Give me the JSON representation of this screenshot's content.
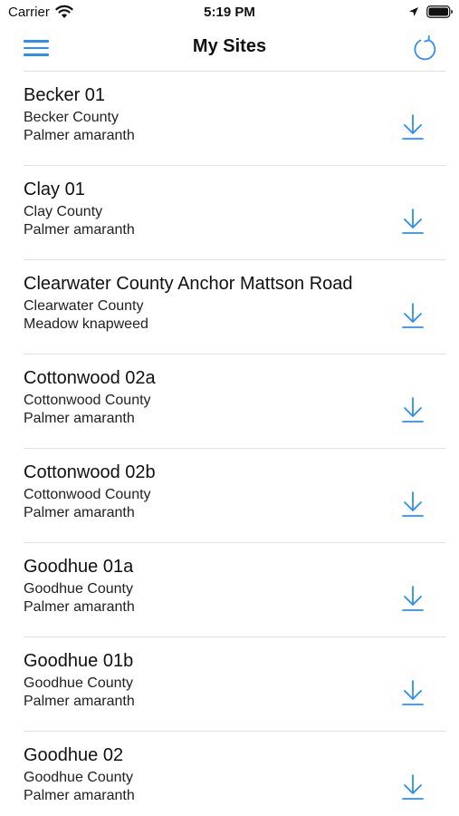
{
  "status_bar": {
    "carrier": "Carrier",
    "time": "5:19 PM"
  },
  "nav": {
    "title": "My Sites",
    "menu_icon": "hamburger-menu-icon",
    "refresh_icon": "refresh-icon"
  },
  "colors": {
    "accent": "#2e8ef0"
  },
  "sites": [
    {
      "name": "Becker 01",
      "county": "Becker County",
      "species": "Palmer amaranth"
    },
    {
      "name": "Clay 01",
      "county": "Clay County",
      "species": "Palmer amaranth"
    },
    {
      "name": "Clearwater County Anchor Mattson Road",
      "county": "Clearwater County",
      "species": "Meadow knapweed"
    },
    {
      "name": "Cottonwood 02a",
      "county": "Cottonwood County",
      "species": "Palmer amaranth"
    },
    {
      "name": "Cottonwood 02b",
      "county": "Cottonwood County",
      "species": "Palmer amaranth"
    },
    {
      "name": "Goodhue 01a",
      "county": "Goodhue County",
      "species": "Palmer amaranth"
    },
    {
      "name": "Goodhue 01b",
      "county": "Goodhue County",
      "species": "Palmer amaranth"
    },
    {
      "name": "Goodhue 02",
      "county": "Goodhue County",
      "species": "Palmer amaranth"
    }
  ]
}
